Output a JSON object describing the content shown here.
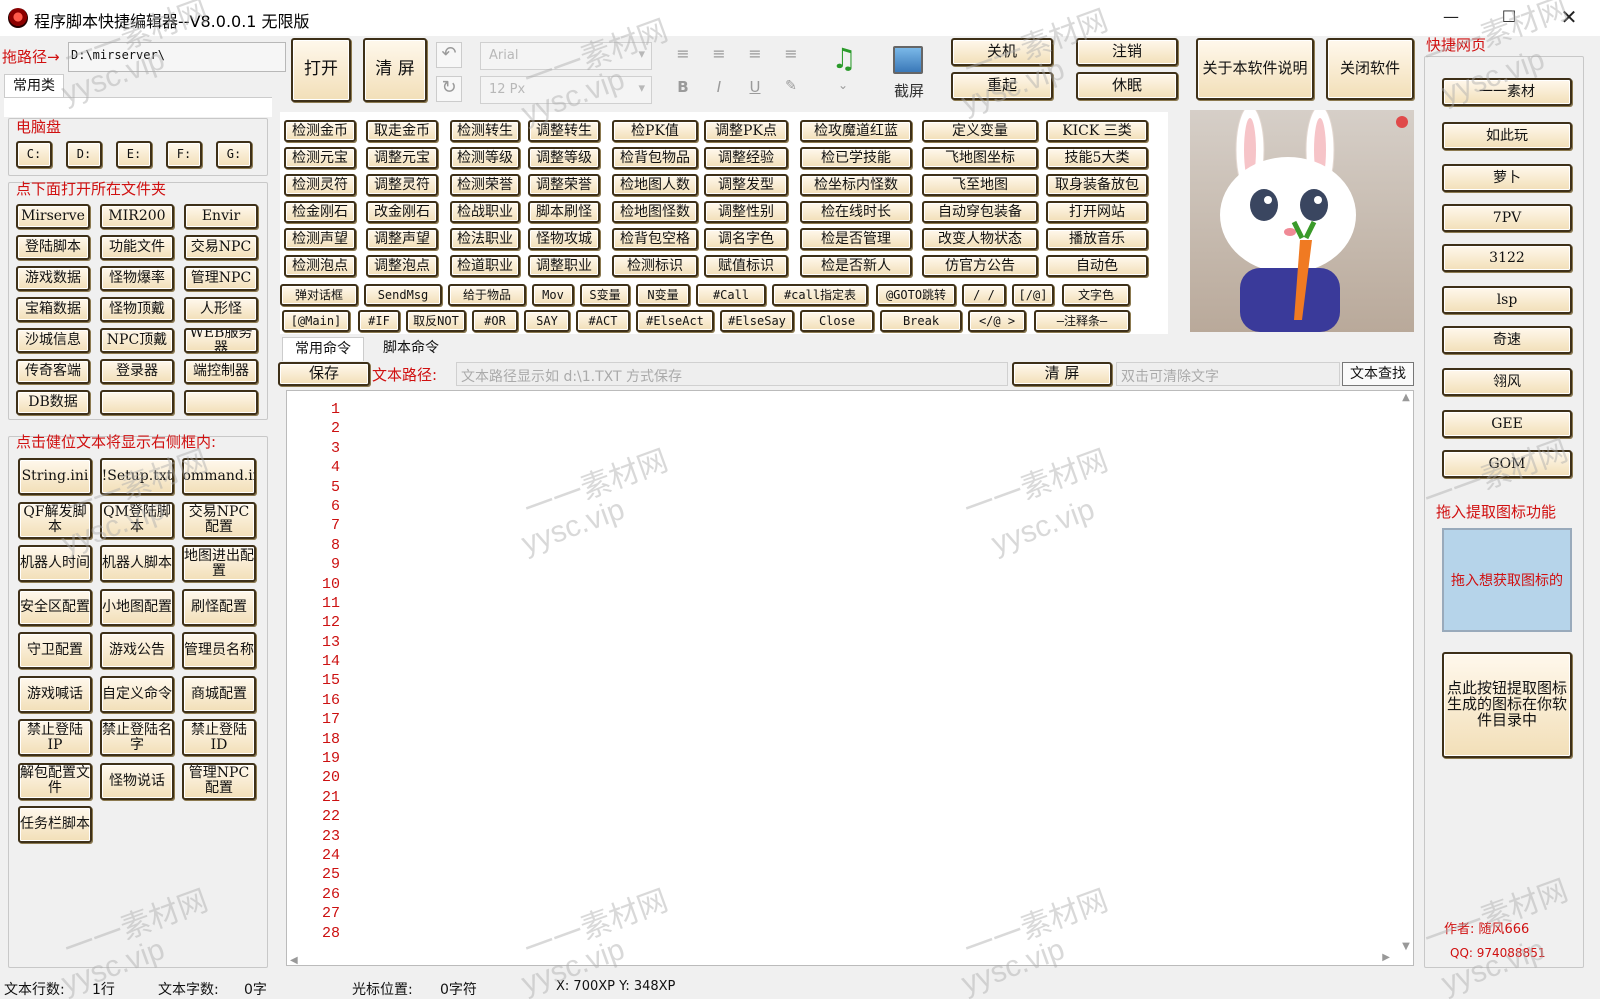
{
  "window": {
    "title": "程序脚本快捷编辑器--V8.0.0.1 无限版"
  },
  "left": {
    "path_label": "拖路径→",
    "path_value": "D:\\mirserver\\",
    "tab": "常用类",
    "drives_title": "电脑盘",
    "drives": [
      "C:",
      "D:",
      "E:",
      "F:",
      "G:"
    ],
    "folders_title": "点下面打开所在文件夹",
    "folders": [
      "Mirserve",
      "MIR200",
      "Envir",
      "登陆脚本",
      "功能文件",
      "交易NPC",
      "游戏数据",
      "怪物爆率",
      "管理NPC",
      "宝箱数据",
      "怪物顶戴",
      "人形怪",
      "沙城信息",
      "NPC顶戴",
      "WEB服务器",
      "传奇客端",
      "登录器",
      "端控制器",
      "DB数据",
      "",
      ""
    ],
    "files_title": "点击健位文本将显示右侧框内:",
    "files": [
      "String.ini",
      "!Setup.txt",
      "Command.ini",
      "QF解发脚本",
      "QM登陆脚本",
      "交易NPC配置",
      "机器人时间",
      "机器人脚本",
      "地图进出配置",
      "安全区配置",
      "小地图配置",
      "刷怪配置",
      "守卫配置",
      "游戏公告",
      "管理员名称",
      "游戏喊话",
      "自定义命令",
      "商城配置",
      "禁止登陆IP",
      "禁止登陆名字",
      "禁止登陆ID",
      "解包配置文件",
      "怪物说话",
      "管理NPC配置",
      "任务栏脚本"
    ]
  },
  "toolbar": {
    "open": "打开",
    "clear": "清 屏",
    "font": "Arial",
    "size": "12 Px",
    "bold": "B",
    "italic": "I",
    "underline": "U",
    "screenshot": "截屏",
    "shutdown": "关机",
    "logout": "注销",
    "restart": "重起",
    "sleep": "休眠",
    "about": "关于本软件说明",
    "close_app": "关闭软件"
  },
  "commands": [
    [
      "检测金币",
      "取走金币",
      "检测转生",
      "调整转生",
      "检PK值",
      "调整PK点",
      "检攻魔道红蓝",
      "定义变量",
      "KICK 三类"
    ],
    [
      "检测元宝",
      "调整元宝",
      "检测等级",
      "调整等级",
      "检背包物品",
      "调整经验",
      "检已学技能",
      "飞地图坐标",
      "技能5大类"
    ],
    [
      "检测灵符",
      "调整灵符",
      "检测荣誉",
      "调整荣誉",
      "检地图人数",
      "调整发型",
      "检坐标内怪数",
      "飞至地图",
      "取身装备放包"
    ],
    [
      "检金刚石",
      "改金刚石",
      "检战职业",
      "脚本刷怪",
      "检地图怪数",
      "调整性别",
      "检在线时长",
      "自动穿包装备",
      "打开网站"
    ],
    [
      "检测声望",
      "调整声望",
      "检法职业",
      "怪物攻城",
      "检背包空格",
      "调名字色",
      "检是否管理",
      "改变人物状态",
      "播放音乐"
    ],
    [
      "检测泡点",
      "调整泡点",
      "检道职业",
      "调整职业",
      "检测标识",
      "赋值标识",
      "检是否新人",
      "仿官方公告",
      "自动色"
    ]
  ],
  "script_row1": [
    "弹对话框",
    "SendMsg",
    "给于物品",
    "Mov",
    "S变量",
    "N变量",
    "#Call",
    "#call指定表",
    "@GOTO跳转",
    "/  /",
    "[/@]",
    "文字色"
  ],
  "script_row2": [
    "[@Main]",
    "#IF",
    "取反NOT",
    "#OR",
    "SAY",
    "#ACT",
    "#ElseAct",
    "#ElseSay",
    "Close",
    "Break",
    "</@ >",
    "—注释条—"
  ],
  "editor": {
    "tab1": "常用命令",
    "tab2": "脚本命令",
    "save": "保存",
    "path_label": "文本路径:",
    "path_placeholder": "文本路径显示如 d:\\1.TXT 方式保存",
    "clear": "清 屏",
    "search_placeholder": "双击可清除文字",
    "search_button": "文本查找",
    "line_numbers": [
      "1",
      "2",
      "3",
      "4",
      "5",
      "6",
      "7",
      "8",
      "9",
      "10",
      "11",
      "12",
      "13",
      "14",
      "15",
      "16",
      "17",
      "18",
      "19",
      "20",
      "21",
      "22",
      "23",
      "24",
      "25",
      "26",
      "27",
      "28"
    ]
  },
  "right": {
    "title": "快捷网页",
    "links": [
      "一一素材",
      "如此玩",
      "萝卜",
      "7PV",
      "3122",
      "lsp",
      "奇速",
      "翎风",
      "GEE",
      "GOM"
    ],
    "icon_title": "拖入提取图标功能",
    "drop_text": "拖入想获取图标的",
    "extract_button": "点此按钮提取图标生成的图标在你软件目录中",
    "author": "作者: 随风666",
    "qq": "QQ: 974088851"
  },
  "status": {
    "rows_label": "文本行数:",
    "rows_value": "1行",
    "chars_label": "文本字数:",
    "chars_value": "0字",
    "cursor_label": "光标位置:",
    "cursor_value": "0字符",
    "coords": "X: 700XP  Y: 348XP"
  },
  "watermark": {
    "line1": "一一素材网",
    "line2": "yysc.vip"
  },
  "colors": {
    "accent_red": "#d01010",
    "button_border": "#3e3018",
    "button_fill": "#f7e8c6"
  }
}
